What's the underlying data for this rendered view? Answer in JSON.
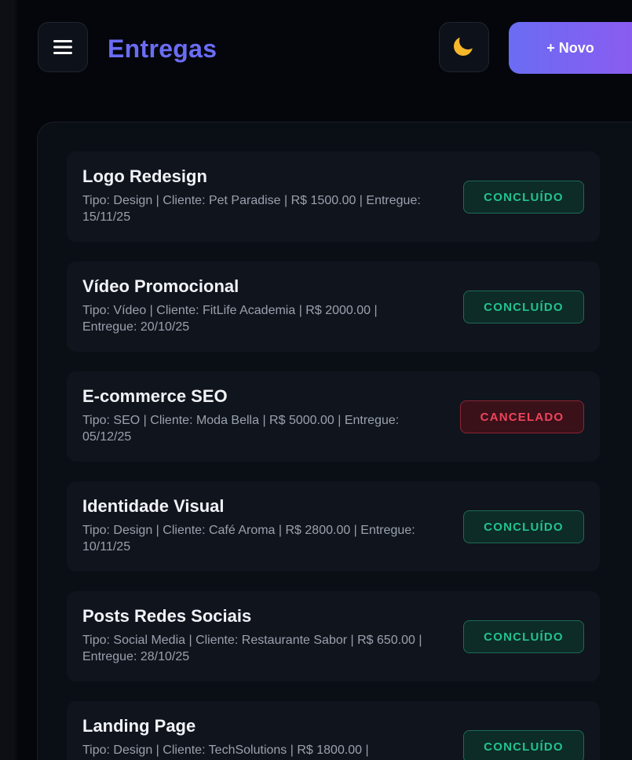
{
  "header": {
    "title": "Entregas",
    "menu_icon": "hamburger-menu-icon",
    "theme_icon": "moon-icon",
    "new_button_label": "+ Novo"
  },
  "colors": {
    "accent": "#6b6cf5",
    "success": "#22c38e",
    "danger": "#f0435c"
  },
  "deliveries": [
    {
      "title": "Logo Redesign",
      "meta": "Tipo: Design | Cliente: Pet Paradise | R$ 1500.00 | Entregue: 15/11/25",
      "status": "CONCLUÍDO",
      "status_kind": "done"
    },
    {
      "title": "Vídeo Promocional",
      "meta": "Tipo: Vídeo | Cliente: FitLife Academia | R$ 2000.00 | Entregue: 20/10/25",
      "status": "CONCLUÍDO",
      "status_kind": "done"
    },
    {
      "title": "E-commerce SEO",
      "meta": "Tipo: SEO | Cliente: Moda Bella | R$ 5000.00 | Entregue: 05/12/25",
      "status": "CANCELADO",
      "status_kind": "cancel"
    },
    {
      "title": "Identidade Visual",
      "meta": "Tipo: Design | Cliente: Café Aroma | R$ 2800.00 | Entregue: 10/11/25",
      "status": "CONCLUÍDO",
      "status_kind": "done"
    },
    {
      "title": "Posts Redes Sociais",
      "meta": "Tipo: Social Media | Cliente: Restaurante Sabor | R$ 650.00 | Entregue: 28/10/25",
      "status": "CONCLUÍDO",
      "status_kind": "done"
    },
    {
      "title": "Landing Page",
      "meta": "Tipo: Design | Cliente: TechSolutions | R$ 1800.00 |",
      "status": "CONCLUÍDO",
      "status_kind": "done"
    }
  ]
}
